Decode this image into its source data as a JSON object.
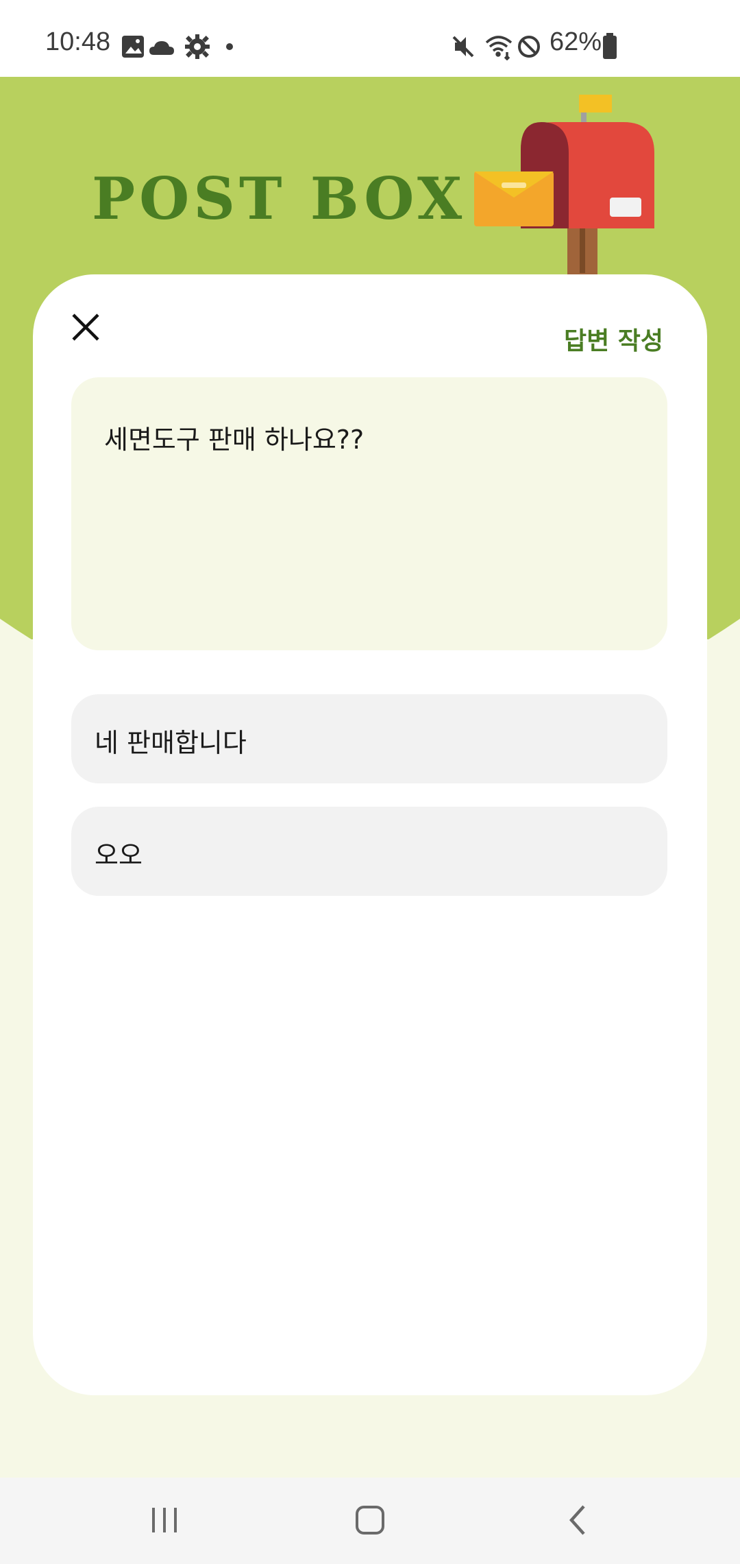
{
  "status_bar": {
    "time": "10:48",
    "battery": "62%",
    "icons_left": [
      "gallery-icon",
      "cloud-icon",
      "settings-icon",
      "dot-icon"
    ],
    "icons_right": [
      "mute-icon",
      "wifi-icon",
      "do-not-disturb-icon",
      "battery-icon"
    ]
  },
  "header": {
    "title": "POST BOX",
    "colors": {
      "accent": "#4a7d23",
      "header_bg": "#b8d05e",
      "page_bg": "#f6f8e6"
    }
  },
  "card": {
    "write_reply_label": "답변 작성",
    "question": "세면도구 판매 하나요??",
    "replies": [
      "네 판매합니다",
      "오오"
    ]
  },
  "nav_bar": {
    "buttons": [
      "recent-apps-icon",
      "home-icon",
      "back-icon"
    ]
  }
}
